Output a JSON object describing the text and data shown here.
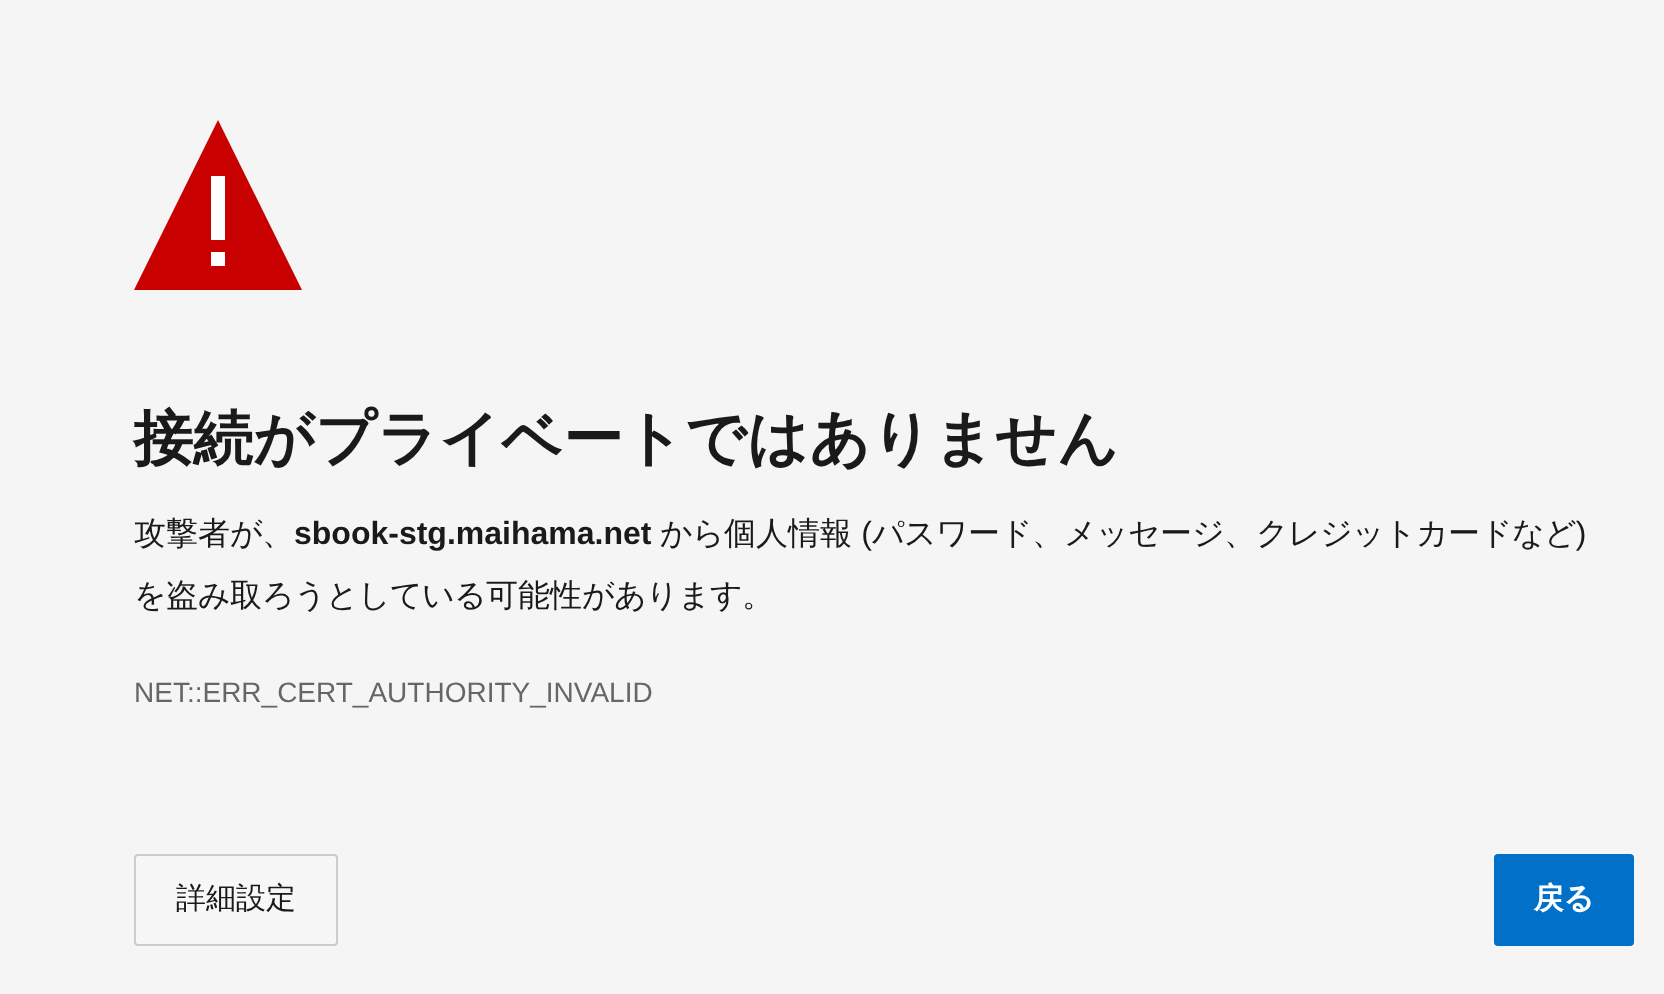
{
  "heading": "接続がプライベートではありません",
  "message": "攻撃者が、**sbook-stg.maihama.net** から個人情報 (パスワード、メッセージ、クレジットカードなど) を盗み取ろうとしている可能性があります。",
  "error_code": "NET::ERR_CERT_AUTHORITY_INVALID",
  "buttons": [
    {
      "label": "詳細設定",
      "kind": "secondary"
    },
    {
      "label": "戻る",
      "kind": "primary"
    }
  ]
}
